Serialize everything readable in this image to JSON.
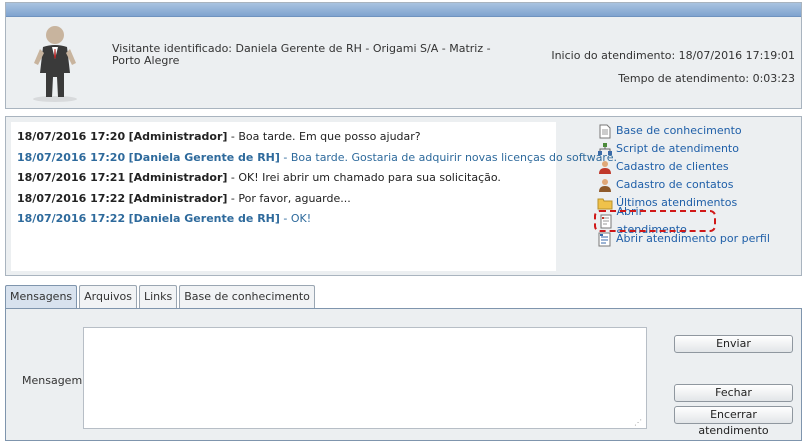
{
  "visitor": {
    "identified": "Visitante identificado: Daniela Gerente de RH - Origami S/A - Matriz - Porto Alegre",
    "start_time": "Inicio do atendimento: 18/07/2016 17:19:01",
    "elapsed_time": "Tempo de atendimento: 0:03:23"
  },
  "chat": {
    "messages": [
      {
        "time": "18/07/2016 17:20",
        "author": "[Administrador]",
        "text": " - Boa tarde. Em que posso ajudar?",
        "type": "admin"
      },
      {
        "time": "18/07/2016 17:20",
        "author": "[Daniela Gerente de RH]",
        "text": " - Boa tarde. Gostaria de adquirir novas licenças do software.",
        "type": "user"
      },
      {
        "time": "18/07/2016 17:21",
        "author": "[Administrador]",
        "text": " - OK! Irei abrir um chamado para sua solicitação.",
        "type": "admin"
      },
      {
        "time": "18/07/2016 17:22",
        "author": "[Administrador]",
        "text": " - Por favor, aguarde...",
        "type": "admin"
      },
      {
        "time": "18/07/2016 17:22",
        "author": "[Daniela Gerente de RH]",
        "text": " - OK!",
        "type": "user"
      }
    ]
  },
  "links": [
    {
      "label": "Base de conhecimento",
      "icon": "document-icon"
    },
    {
      "label": "Script de atendimento",
      "icon": "flowchart-icon"
    },
    {
      "label": "Cadastro de clientes",
      "icon": "client-icon"
    },
    {
      "label": "Cadastro de contatos",
      "icon": "contact-icon"
    },
    {
      "label": "Últimos atendimentos",
      "icon": "folder-icon"
    },
    {
      "label": "Abrir atendimento",
      "icon": "ticket-icon"
    },
    {
      "label": "Abrir atendimento por perfil",
      "icon": "profile-ticket-icon"
    }
  ],
  "tabs": [
    "Mensagens",
    "Arquivos",
    "Links",
    "Base de conhecimento"
  ],
  "compose": {
    "label": "Mensagem:",
    "value": "",
    "send_label": "Enviar",
    "close_label": "Fechar",
    "end_label": "Encerrar atendimento"
  },
  "colors": {
    "admin_text": "#222222",
    "user_text": "#2e6a9c",
    "link": "#1f5fa8",
    "highlight": "#d01818"
  }
}
